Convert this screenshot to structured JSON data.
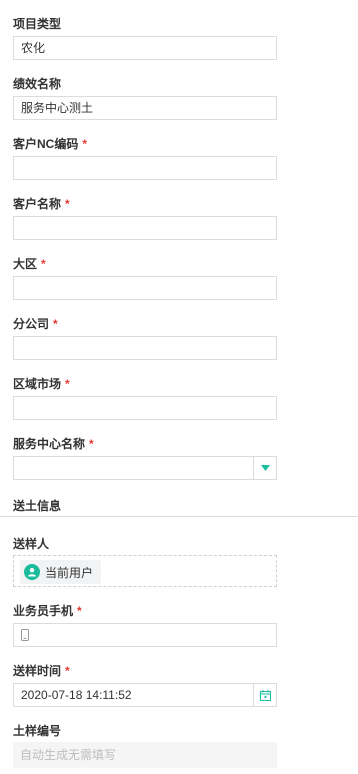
{
  "form": {
    "project_type": {
      "label": "项目类型",
      "value": "农化"
    },
    "performance_name": {
      "label": "绩效名称",
      "value": "服务中心测土"
    },
    "customer_nc_code": {
      "label": "客户NC编码",
      "required_mark": "*",
      "value": ""
    },
    "customer_name": {
      "label": "客户名称",
      "required_mark": "*",
      "value": ""
    },
    "region": {
      "label": "大区",
      "required_mark": "*",
      "value": ""
    },
    "branch_company": {
      "label": "分公司",
      "required_mark": "*",
      "value": ""
    },
    "regional_market": {
      "label": "区域市场",
      "required_mark": "*",
      "value": ""
    },
    "service_center_name": {
      "label": "服务中心名称",
      "required_mark": "*",
      "value": ""
    }
  },
  "soil_section": {
    "title": "送土信息",
    "sender": {
      "label": "送样人",
      "chip_text": "当前用户"
    },
    "salesman_phone": {
      "label": "业务员手机",
      "required_mark": "*",
      "value": ""
    },
    "send_time": {
      "label": "送样时间",
      "required_mark": "*",
      "value": "2020-07-18 14:11:52"
    },
    "soil_number": {
      "label": "土样编号",
      "placeholder": "自动生成无需填写"
    }
  },
  "icons": {
    "dropdown": "caret-down-icon",
    "user": "user-icon",
    "phone": "phone-icon",
    "calendar": "calendar-icon"
  },
  "colors": {
    "accent": "#1abc9c",
    "required": "#e53935",
    "border": "#dcdcdc"
  }
}
